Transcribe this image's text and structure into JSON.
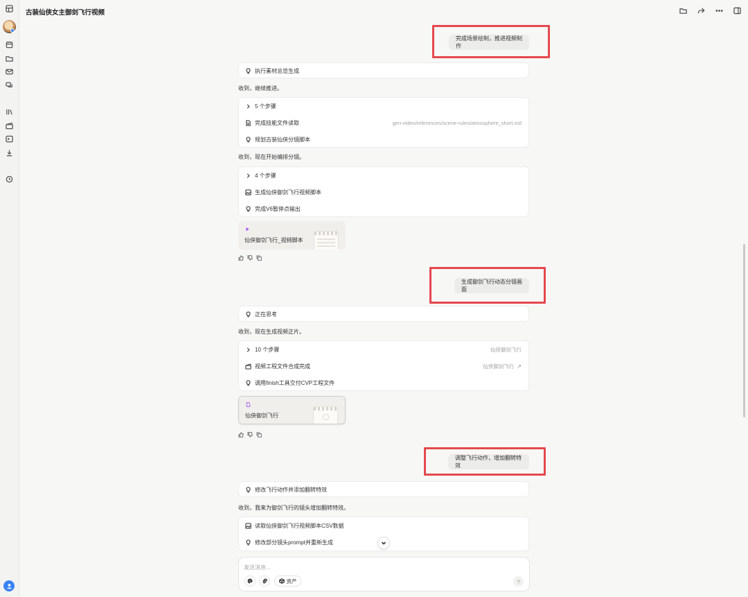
{
  "header": {
    "title": "古装仙侠女主御剑飞行视频",
    "icons": [
      "folder-icon",
      "share-icon",
      "more-icon",
      "panel-icon"
    ]
  },
  "sidebar": {
    "icons": [
      "layout-icon",
      "avatar",
      "calendar-icon",
      "folder-icon",
      "mail-icon",
      "chat-icon",
      "library-icon",
      "clapperboard-icon",
      "terminal-icon",
      "download-icon",
      "history-icon"
    ]
  },
  "messages": {
    "m1": {
      "user": "完成场景绘制，推进视频制作",
      "thinking": "执行素材总览生成",
      "reply": "收到，继续推进。",
      "steps_toggle": "5 个步骤",
      "step1": "完成技能文件读取",
      "step1_meta": "gen-video/references/scene-rules/atmosphere_short.md",
      "step2": "规划古装仙侠分镜脚本"
    },
    "m2": {
      "reply": "收到，现在开始编排分镜。",
      "steps_toggle": "4 个步骤",
      "step1": "生成仙侠御剑飞行视频脚本",
      "step2": "完成V6暂停点输出",
      "file_name": "仙侠御剑飞行_视频脚本"
    },
    "m3": {
      "user": "生成御剑飞行动态分镜画面",
      "thinking": "正在思考",
      "reply": "收到，现在生成视频正片。",
      "steps_toggle": "10 个步骤",
      "steps_meta": "仙侠御剑飞行",
      "step1": "视频工程文件合成完成",
      "step1_meta": "仙侠御剑飞行",
      "step1_arrow": "↗",
      "step2": "调用finish工具交付CVP工程文件",
      "file_name": "仙侠御剑飞行"
    },
    "m4": {
      "user": "调整飞行动作，增加翻转特效",
      "thinking": "修改飞行动作并添加翻转特效",
      "reply": "收到，我来为御剑飞行的镜头增加翻转特效。",
      "step1": "读取仙侠御剑飞行视频脚本CSV数据",
      "step2": "修改部分镜头prompt并重新生成"
    }
  },
  "composer": {
    "placeholder": "发送消息...",
    "assets_label": "资产"
  },
  "colors": {
    "highlight": "#e5484d",
    "accent": "#3b82f6",
    "file_tag": "#a855f7"
  }
}
